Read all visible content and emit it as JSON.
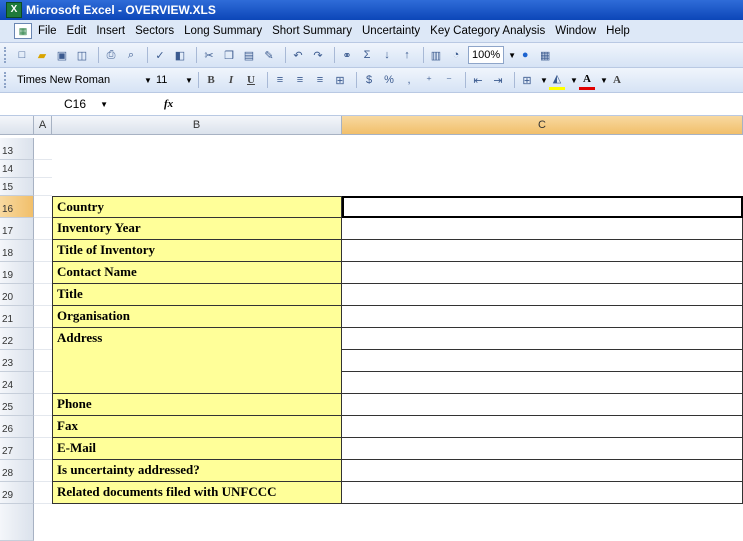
{
  "window": {
    "title": "Microsoft Excel - OVERVIEW.XLS"
  },
  "menu": [
    "File",
    "Edit",
    "Insert",
    "Sectors",
    "Long Summary",
    "Short Summary",
    "Uncertainty",
    "Key Category Analysis",
    "Window",
    "Help"
  ],
  "toolbar": {
    "zoom": "100%"
  },
  "format_toolbar": {
    "font": "Times New Roman",
    "size": "11",
    "currency": "$",
    "percent": "%"
  },
  "formula_bar": {
    "cell_ref": "C16",
    "fx_label": "fx",
    "value": ""
  },
  "columns": {
    "a": "A",
    "b": "B",
    "c": "C"
  },
  "rows": [
    {
      "num": "13",
      "label": ""
    },
    {
      "num": "14",
      "label": ""
    },
    {
      "num": "15",
      "label": ""
    },
    {
      "num": "16",
      "label": "Country"
    },
    {
      "num": "17",
      "label": "Inventory Year"
    },
    {
      "num": "18",
      "label": "Title of Inventory"
    },
    {
      "num": "19",
      "label": "Contact Name"
    },
    {
      "num": "20",
      "label": "Title"
    },
    {
      "num": "21",
      "label": "Organisation"
    },
    {
      "num": "22",
      "label": "Address"
    },
    {
      "num": "23",
      "label": ""
    },
    {
      "num": "24",
      "label": ""
    },
    {
      "num": "25",
      "label": "Phone"
    },
    {
      "num": "26",
      "label": "Fax"
    },
    {
      "num": "27",
      "label": "E-Mail"
    },
    {
      "num": "28",
      "label": "Is uncertainty addressed?"
    },
    {
      "num": "29",
      "label": "Related documents filed with UNFCCC"
    }
  ]
}
